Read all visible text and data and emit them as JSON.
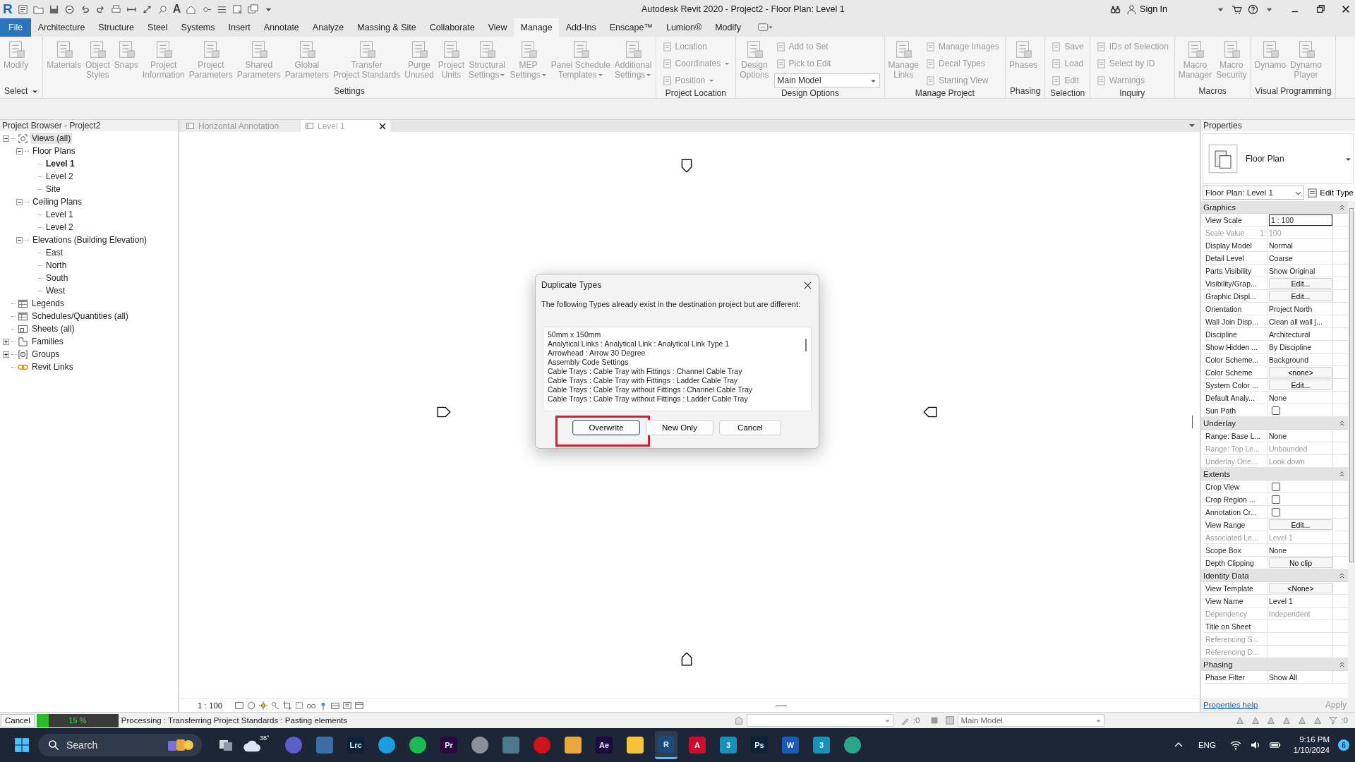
{
  "window": {
    "app_logo": "R",
    "text_tool": "A",
    "title": "Autodesk Revit 2020 - Project2 - Floor Plan: Level 1",
    "sign_in": "Sign In"
  },
  "menu_tabs": [
    {
      "label": "File",
      "kind": "file",
      "selected": false
    },
    {
      "label": "Architecture",
      "kind": "tab",
      "selected": false
    },
    {
      "label": "Structure",
      "kind": "tab",
      "selected": false
    },
    {
      "label": "Steel",
      "kind": "tab",
      "selected": false
    },
    {
      "label": "Systems",
      "kind": "tab",
      "selected": false
    },
    {
      "label": "Insert",
      "kind": "tab",
      "selected": false
    },
    {
      "label": "Annotate",
      "kind": "tab",
      "selected": false
    },
    {
      "label": "Analyze",
      "kind": "tab",
      "selected": false
    },
    {
      "label": "Massing & Site",
      "kind": "tab",
      "selected": false
    },
    {
      "label": "Collaborate",
      "kind": "tab",
      "selected": false
    },
    {
      "label": "View",
      "kind": "tab",
      "selected": false
    },
    {
      "label": "Manage",
      "kind": "tab",
      "selected": true
    },
    {
      "label": "Add-Ins",
      "kind": "tab",
      "selected": false
    },
    {
      "label": "Enscape™",
      "kind": "tab",
      "selected": false
    },
    {
      "label": "Lumion®",
      "kind": "tab",
      "selected": false
    },
    {
      "label": "Modify",
      "kind": "tab",
      "selected": false
    }
  ],
  "ribbon": {
    "panels": [
      {
        "label": "Select",
        "has_menu": true,
        "items": [
          {
            "kind": "large",
            "label": "Modify",
            "has_menu": false
          }
        ]
      },
      {
        "label": "Settings",
        "has_menu": false,
        "items": [
          {
            "kind": "large",
            "label": "Materials",
            "has_menu": false
          },
          {
            "kind": "large",
            "label": "Object\nStyles",
            "has_menu": false
          },
          {
            "kind": "large",
            "label": "Snaps",
            "has_menu": false
          },
          {
            "kind": "large",
            "label": "Project\nInformation",
            "has_menu": false
          },
          {
            "kind": "large",
            "label": "Project\nParameters",
            "has_menu": false
          },
          {
            "kind": "large",
            "label": "Shared\nParameters",
            "has_menu": false
          },
          {
            "kind": "large",
            "label": "Global\nParameters",
            "has_menu": false
          },
          {
            "kind": "large",
            "label": "Transfer\nProject Standards",
            "has_menu": false
          },
          {
            "kind": "large",
            "label": "Purge\nUnused",
            "has_menu": false
          },
          {
            "kind": "large",
            "label": "Project\nUnits",
            "has_menu": false
          },
          {
            "kind": "large",
            "label": "Structural\nSettings",
            "has_menu": true
          },
          {
            "kind": "large",
            "label": "MEP\nSettings",
            "has_menu": true
          },
          {
            "kind": "large",
            "label": "Panel Schedule\nTemplates",
            "has_menu": true
          },
          {
            "kind": "large",
            "label": "Additional\nSettings",
            "has_menu": true
          }
        ]
      },
      {
        "label": "Project Location",
        "has_menu": false,
        "items": [
          {
            "kind": "stack",
            "tools": [
              {
                "kind": "small",
                "label": "Location",
                "has_menu": false
              },
              {
                "kind": "small",
                "label": "Coordinates",
                "has_menu": true
              },
              {
                "kind": "small",
                "label": "Position",
                "has_menu": true
              }
            ]
          }
        ]
      },
      {
        "label": "Design Options",
        "has_menu": false,
        "items": [
          {
            "kind": "large",
            "label": "Design\nOptions",
            "has_menu": false
          },
          {
            "kind": "stack",
            "tools": [
              {
                "kind": "small",
                "label": "Add to Set",
                "has_menu": false
              },
              {
                "kind": "small",
                "label": "Pick to Edit",
                "has_menu": false
              },
              {
                "kind": "dropdown",
                "label": "Main Model",
                "has_menu": true
              }
            ]
          }
        ]
      },
      {
        "label": "Manage Project",
        "has_menu": false,
        "items": [
          {
            "kind": "large",
            "label": "Manage\nLinks",
            "has_menu": false
          },
          {
            "kind": "stack",
            "tools": [
              {
                "kind": "small",
                "label": "Manage Images",
                "has_menu": false
              },
              {
                "kind": "small",
                "label": "Decal Types",
                "has_menu": false
              },
              {
                "kind": "small",
                "label": "Starting View",
                "has_menu": false
              }
            ]
          }
        ]
      },
      {
        "label": "Phasing",
        "has_menu": false,
        "items": [
          {
            "kind": "large",
            "label": "Phases",
            "has_menu": false
          }
        ]
      },
      {
        "label": "Selection",
        "has_menu": false,
        "items": [
          {
            "kind": "stack",
            "tools": [
              {
                "kind": "small",
                "label": "Save",
                "has_menu": false
              },
              {
                "kind": "small",
                "label": "Load",
                "has_menu": false
              },
              {
                "kind": "small",
                "label": "Edit",
                "has_menu": false
              }
            ]
          }
        ]
      },
      {
        "label": "Inquiry",
        "has_menu": false,
        "items": [
          {
            "kind": "stack",
            "tools": [
              {
                "kind": "small",
                "label": "IDs of Selection",
                "has_menu": false
              },
              {
                "kind": "small",
                "label": "Select by ID",
                "has_menu": false
              },
              {
                "kind": "small",
                "label": "Warnings",
                "has_menu": false
              }
            ]
          }
        ]
      },
      {
        "label": "Macros",
        "has_menu": false,
        "items": [
          {
            "kind": "large",
            "label": "Macro\nManager",
            "has_menu": false
          },
          {
            "kind": "large",
            "label": "Macro\nSecurity",
            "has_menu": false
          }
        ]
      },
      {
        "label": "Visual Programming",
        "has_menu": false,
        "items": [
          {
            "kind": "large",
            "label": "Dynamo",
            "has_menu": false
          },
          {
            "kind": "large",
            "label": "Dynamo\nPlayer",
            "has_menu": false
          }
        ]
      }
    ]
  },
  "browser": {
    "title": "Project Browser - Project2",
    "tree": [
      {
        "label": "Views (all)",
        "kind": "views",
        "expanded": true,
        "selected": true,
        "current": false,
        "children": [
          {
            "label": "Floor Plans",
            "expanded": true,
            "selected": false,
            "current": false,
            "children": [
              {
                "label": "Level 1",
                "selected": false,
                "current": true
              },
              {
                "label": "Level 2",
                "selected": false,
                "current": false
              },
              {
                "label": "Site",
                "selected": false,
                "current": false
              }
            ]
          },
          {
            "label": "Ceiling Plans",
            "expanded": true,
            "selected": false,
            "current": false,
            "children": [
              {
                "label": "Level 1",
                "selected": false,
                "current": false
              },
              {
                "label": "Level 2",
                "selected": false,
                "current": false
              }
            ]
          },
          {
            "label": "Elevations (Building Elevation)",
            "expanded": true,
            "selected": false,
            "current": false,
            "children": [
              {
                "label": "East",
                "selected": false,
                "current": false
              },
              {
                "label": "North",
                "selected": false,
                "current": false
              },
              {
                "label": "South",
                "selected": false,
                "current": false
              },
              {
                "label": "West",
                "selected": false,
                "current": false
              }
            ]
          }
        ]
      },
      {
        "label": "Legends",
        "kind": "legends",
        "selected": false,
        "current": false
      },
      {
        "label": "Schedules/Quantities (all)",
        "kind": "schedules",
        "selected": false,
        "current": false
      },
      {
        "label": "Sheets (all)",
        "kind": "sheets",
        "selected": false,
        "current": false
      },
      {
        "label": "Families",
        "kind": "families",
        "expanded": false,
        "selected": false,
        "current": false
      },
      {
        "label": "Groups",
        "kind": "groups",
        "expanded": false,
        "selected": false,
        "current": false
      },
      {
        "label": "Revit Links",
        "kind": "links",
        "selected": false,
        "current": false
      }
    ]
  },
  "view_tabs": [
    {
      "label": "Horizontal Annotation",
      "selected": false
    },
    {
      "label": "Level 1",
      "selected": true
    }
  ],
  "canvas": {
    "markers": [
      {
        "kind": "down"
      },
      {
        "kind": "right"
      },
      {
        "kind": "left"
      },
      {
        "kind": "up"
      }
    ]
  },
  "view_control": {
    "scale": "1 : 100"
  },
  "dialog": {
    "title": "Duplicate Types",
    "message": "The following Types already exist in the destination project but are different:",
    "items": [
      "50mm x 150mm",
      "Analytical Links : Analytical Link : Analytical Link Type 1",
      "Arrowhead : Arrow 30 Degree",
      "Assembly Code Settings",
      "Cable Trays : Cable Tray with Fittings : Channel Cable Tray",
      "Cable Trays : Cable Tray with Fittings : Ladder Cable Tray",
      "Cable Trays : Cable Tray without Fittings : Channel Cable Tray",
      "Cable Trays : Cable Tray without Fittings : Ladder Cable Tray"
    ],
    "buttons": [
      {
        "label": "Overwrite",
        "default": true,
        "annotated": true
      },
      {
        "label": "New Only",
        "default": false,
        "annotated": false
      },
      {
        "label": "Cancel",
        "default": false,
        "annotated": false
      }
    ]
  },
  "properties": {
    "title": "Properties",
    "type_name": "Floor Plan",
    "instance_selector": "Floor Plan: Level 1",
    "edit_type": "Edit Type",
    "groups": [
      {
        "name": "Graphics",
        "expanded": true,
        "rows": [
          {
            "name": "View Scale",
            "value": "1 : 100",
            "kind": "field",
            "disabled": false
          },
          {
            "name": "Scale Value",
            "unit": "1:",
            "value": "100",
            "kind": "text",
            "disabled": true
          },
          {
            "name": "Display Model",
            "value": "Normal",
            "kind": "text",
            "disabled": false
          },
          {
            "name": "Detail Level",
            "value": "Coarse",
            "kind": "text",
            "disabled": false
          },
          {
            "name": "Parts Visibility",
            "value": "Show Original",
            "kind": "text",
            "disabled": false
          },
          {
            "name": "Visibility/Grap...",
            "value": "Edit...",
            "kind": "button",
            "disabled": false
          },
          {
            "name": "Graphic Displ...",
            "value": "Edit...",
            "kind": "button",
            "disabled": false
          },
          {
            "name": "Orientation",
            "value": "Project North",
            "kind": "text",
            "disabled": false
          },
          {
            "name": "Wall Join Disp...",
            "value": "Clean all wall j...",
            "kind": "text",
            "disabled": false
          },
          {
            "name": "Discipline",
            "value": "Architectural",
            "kind": "text",
            "disabled": false
          },
          {
            "name": "Show Hidden ...",
            "value": "By Discipline",
            "kind": "text",
            "disabled": false
          },
          {
            "name": "Color Scheme...",
            "value": "Background",
            "kind": "text",
            "disabled": false
          },
          {
            "name": "Color Scheme",
            "value": "<none>",
            "kind": "button",
            "disabled": false
          },
          {
            "name": "System Color ...",
            "value": "Edit...",
            "kind": "button",
            "disabled": false
          },
          {
            "name": "Default Analy...",
            "value": "None",
            "kind": "text",
            "disabled": false
          },
          {
            "name": "Sun Path",
            "kind": "checkbox",
            "checked": false,
            "disabled": false
          }
        ]
      },
      {
        "name": "Underlay",
        "expanded": true,
        "rows": [
          {
            "name": "Range: Base L...",
            "value": "None",
            "kind": "text",
            "disabled": false
          },
          {
            "name": "Range: Top Le...",
            "value": "Unbounded",
            "kind": "text",
            "disabled": true
          },
          {
            "name": "Underlay Orie...",
            "value": "Look down",
            "kind": "text",
            "disabled": true
          }
        ]
      },
      {
        "name": "Extents",
        "expanded": true,
        "rows": [
          {
            "name": "Crop View",
            "kind": "checkbox",
            "checked": false,
            "disabled": false
          },
          {
            "name": "Crop Region ...",
            "kind": "checkbox",
            "checked": false,
            "disabled": false
          },
          {
            "name": "Annotation Cr...",
            "kind": "checkbox",
            "checked": false,
            "disabled": false
          },
          {
            "name": "View Range",
            "value": "Edit...",
            "kind": "button",
            "disabled": false
          },
          {
            "name": "Associated Le...",
            "value": "Level 1",
            "kind": "text",
            "disabled": true
          },
          {
            "name": "Scope Box",
            "value": "None",
            "kind": "text",
            "disabled": false
          },
          {
            "name": "Depth Clipping",
            "value": "No clip",
            "kind": "button",
            "disabled": false
          }
        ]
      },
      {
        "name": "Identity Data",
        "expanded": true,
        "rows": [
          {
            "name": "View Template",
            "value": "<None>",
            "kind": "button",
            "disabled": false
          },
          {
            "name": "View Name",
            "value": "Level 1",
            "kind": "text",
            "disabled": false
          },
          {
            "name": "Dependency",
            "value": "Independent",
            "kind": "text",
            "disabled": true
          },
          {
            "name": "Title on Sheet",
            "kind": "text",
            "disabled": false
          },
          {
            "name": "Referencing S...",
            "kind": "text",
            "disabled": true
          },
          {
            "name": "Referencing D...",
            "kind": "text",
            "disabled": true
          }
        ]
      },
      {
        "name": "Phasing",
        "expanded": true,
        "rows": [
          {
            "name": "Phase Filter",
            "value": "Show All",
            "kind": "text",
            "disabled": false
          }
        ]
      }
    ],
    "help": "Properties help",
    "apply": "Apply"
  },
  "status_bar": {
    "cancel": "Cancel",
    "progress": {
      "level": 0.15,
      "reading": "15 %"
    },
    "message": "Processing : Transferring Project Standards : Pasting elements",
    "worksets_count": ":0",
    "active_model": "Main Model",
    "filter_count": ":0"
  },
  "taskbar": {
    "search": {
      "placeholder": "Search"
    },
    "weather": "38°",
    "apps": [
      {
        "kind": "round",
        "color": "#5b5fc7",
        "active": false
      },
      {
        "kind": "tile",
        "color": "#3a6ea5",
        "active": false
      },
      {
        "kind": "tile",
        "label": "Lrc",
        "color": "#0b2237",
        "active": false
      },
      {
        "kind": "round",
        "color": "#1b9de2",
        "active": false
      },
      {
        "kind": "round",
        "color": "#1db954",
        "active": false
      },
      {
        "kind": "tile",
        "label": "Pr",
        "color": "#2a0a3c",
        "active": false
      },
      {
        "kind": "round",
        "color": "#8a8f99",
        "active": false
      },
      {
        "kind": "tile",
        "color": "#4a7a8c",
        "active": false
      },
      {
        "kind": "round",
        "color": "#d0121b",
        "active": false
      },
      {
        "kind": "tile",
        "color": "#e8a93a",
        "active": false
      },
      {
        "kind": "tile",
        "label": "Ae",
        "color": "#1f0a3c",
        "active": false
      },
      {
        "kind": "tile",
        "color": "#f3c33a",
        "active": false
      },
      {
        "kind": "tile",
        "label": "R",
        "color": "#1c4a7a",
        "active": true
      },
      {
        "kind": "tile",
        "label": "A",
        "color": "#c8102e",
        "active": false
      },
      {
        "kind": "tile",
        "label": "3",
        "color": "#1a8fb8",
        "active": false
      },
      {
        "kind": "tile",
        "label": "Ps",
        "color": "#0b2237",
        "active": false
      },
      {
        "kind": "tile",
        "label": "W",
        "color": "#1a5bb5",
        "active": false
      },
      {
        "kind": "tile",
        "label": "3",
        "color": "#1a8fb8",
        "active": false
      },
      {
        "kind": "round",
        "color": "#2aa58b",
        "active": false
      }
    ],
    "tray": {
      "language": "ENG",
      "time": "9:16 PM",
      "date": "1/10/2024",
      "notifications": "6"
    }
  }
}
